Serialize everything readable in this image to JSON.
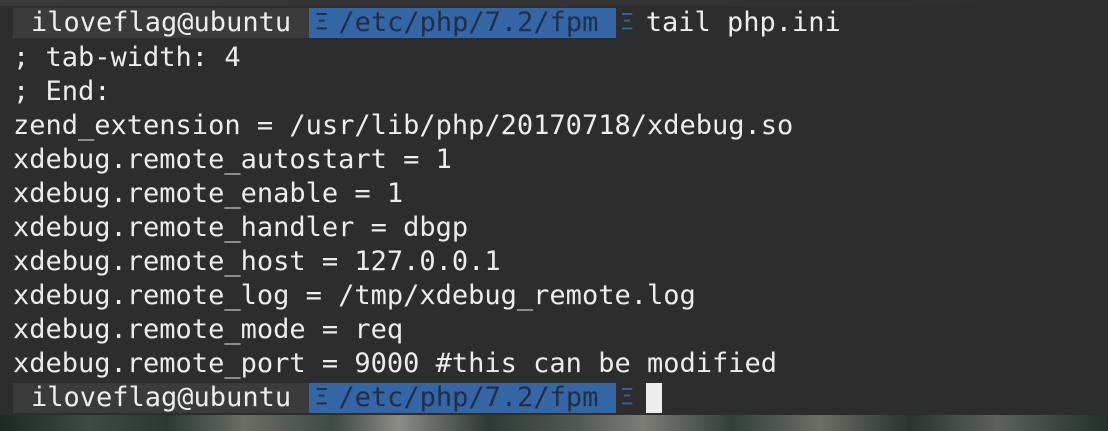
{
  "prompt": {
    "user_host": "iloveflag@ubuntu",
    "path": "/etc/php/7.2/fpm",
    "separator_glyph": "Ξ"
  },
  "command": "tail php.ini",
  "output_lines": [
    "; tab-width: 4",
    "; End:",
    "zend_extension = /usr/lib/php/20170718/xdebug.so",
    "xdebug.remote_autostart = 1",
    "xdebug.remote_enable = 1",
    "xdebug.remote_handler = dbgp",
    "xdebug.remote_host = 127.0.0.1",
    "xdebug.remote_log = /tmp/xdebug_remote.log",
    "xdebug.remote_mode = req",
    "xdebug.remote_port = 9000 #this can be modified"
  ],
  "colors": {
    "background": "#2d2d2d",
    "text": "#ececec",
    "path_segment": "#3465a4",
    "user_segment": "#3b3b3b"
  }
}
